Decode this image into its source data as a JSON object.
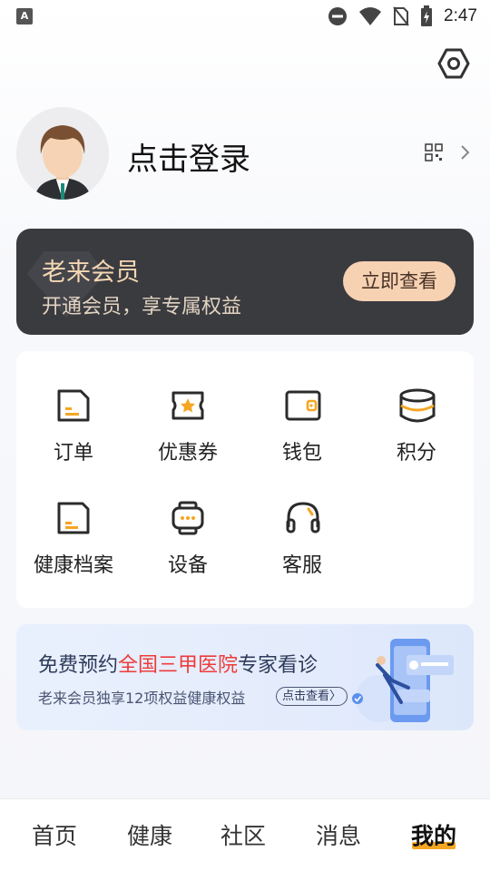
{
  "status_bar": {
    "time": "2:47",
    "left_icon_letter": "A"
  },
  "profile": {
    "login_text": "点击登录"
  },
  "vip": {
    "title": "老来会员",
    "subtitle": "开通会员，享专属权益",
    "button": "立即查看"
  },
  "services": [
    {
      "label": "订单",
      "icon": "order-icon"
    },
    {
      "label": "优惠券",
      "icon": "coupon-icon"
    },
    {
      "label": "钱包",
      "icon": "wallet-icon"
    },
    {
      "label": "积分",
      "icon": "points-icon"
    },
    {
      "label": "健康档案",
      "icon": "health-record-icon"
    },
    {
      "label": "设备",
      "icon": "device-icon"
    },
    {
      "label": "客服",
      "icon": "headset-icon"
    }
  ],
  "banner": {
    "title_prefix": "免费预约",
    "title_highlight": "全国三甲医院",
    "title_suffix": "专家看诊",
    "subtitle": "老来会员独享12项权益健康权益",
    "link": "点击查看",
    "link_arrow": "〉"
  },
  "tabs": [
    {
      "label": "首页"
    },
    {
      "label": "健康"
    },
    {
      "label": "社区"
    },
    {
      "label": "消息"
    },
    {
      "label": "我的"
    }
  ],
  "colors": {
    "accent": "#f5a623",
    "vip_bg": "#3a3b3f",
    "highlight_red": "#ee3b3b"
  }
}
